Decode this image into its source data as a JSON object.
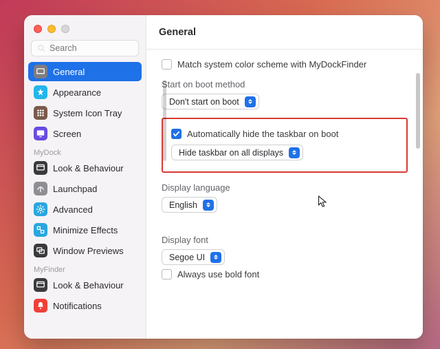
{
  "header": {
    "title": "General"
  },
  "search": {
    "placeholder": "Search"
  },
  "sidebar": {
    "sections": [
      {
        "label": null,
        "items": [
          {
            "label": "General",
            "icon": "general",
            "color": "#7d7d82",
            "selected": true
          },
          {
            "label": "Appearance",
            "icon": "appearance",
            "color": "#23b6ec",
            "selected": false
          },
          {
            "label": "System Icon Tray",
            "icon": "tray",
            "color": "#7b5a4b",
            "selected": false
          },
          {
            "label": "Screen",
            "icon": "screen",
            "color": "#6a4be0",
            "selected": false
          }
        ]
      },
      {
        "label": "MyDock",
        "items": [
          {
            "label": "Look & Behaviour",
            "icon": "look",
            "color": "#3a3a3e",
            "selected": false
          },
          {
            "label": "Launchpad",
            "icon": "launchpad",
            "color": "#8e8e93",
            "selected": false
          },
          {
            "label": "Advanced",
            "icon": "advanced",
            "color": "#2aa6e0",
            "selected": false
          },
          {
            "label": "Minimize Effects",
            "icon": "minimize",
            "color": "#2aa6e0",
            "selected": false
          },
          {
            "label": "Window Previews",
            "icon": "previews",
            "color": "#3a3a3e",
            "selected": false
          }
        ]
      },
      {
        "label": "MyFinder",
        "items": [
          {
            "label": "Look & Behaviour",
            "icon": "look",
            "color": "#3a3a3e",
            "selected": false
          },
          {
            "label": "Notifications",
            "icon": "notify",
            "color": "#ef4038",
            "selected": false
          }
        ]
      }
    ]
  },
  "content": {
    "match_color_label": "Match system color scheme with MyDockFinder",
    "start_heading": "Start on boot method",
    "start_value": "Don't start on boot",
    "auto_hide_label": "Automatically hide the taskbar on boot",
    "auto_hide_value": "Hide taskbar on all displays",
    "lang_heading": "Display language",
    "lang_value": "English",
    "font_heading": "Display font",
    "font_value": "Segoe UI",
    "bold_label": "Always use bold font"
  }
}
